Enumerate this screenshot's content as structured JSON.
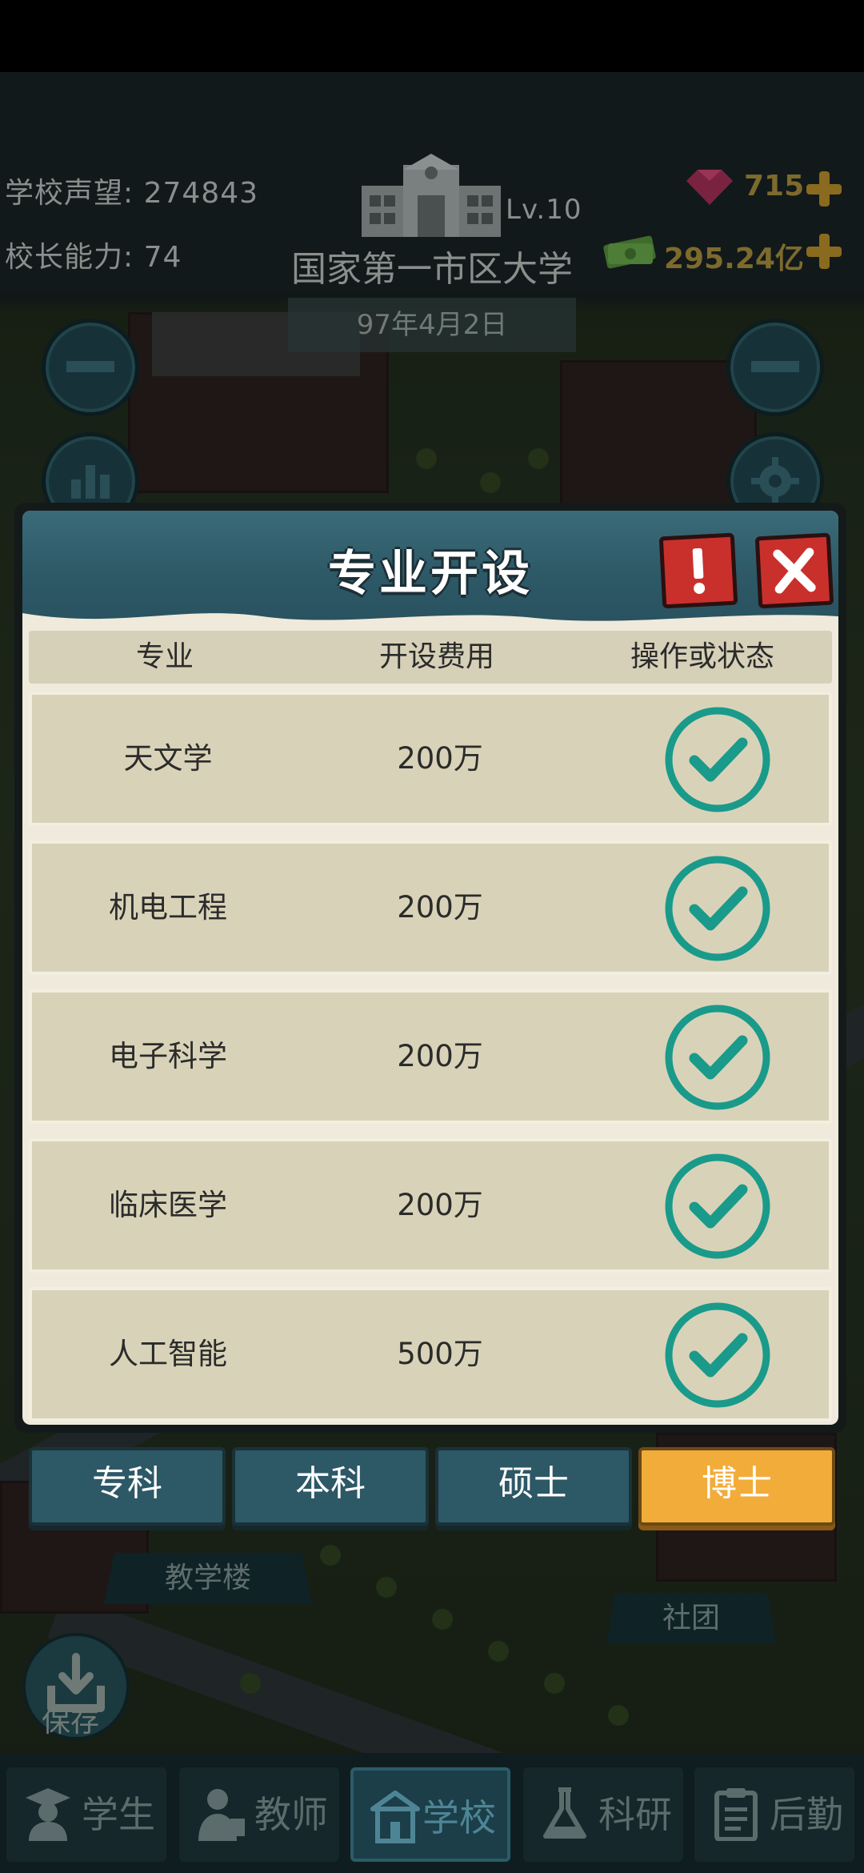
{
  "hud": {
    "reputation_label": "学校声望:",
    "reputation_value": "274843",
    "ability_label": "校长能力:",
    "ability_value": "74",
    "level": "Lv.10",
    "school_name": "国家第一市区大学",
    "date": "97年4月2日",
    "gems": "715",
    "money": "295.24亿"
  },
  "dialog": {
    "title": "专业开设",
    "columns": [
      "专业",
      "开设费用",
      "操作或状态"
    ],
    "rows": [
      {
        "major": "天文学",
        "cost": "200万",
        "status": "opened"
      },
      {
        "major": "机电工程",
        "cost": "200万",
        "status": "opened"
      },
      {
        "major": "电子科学",
        "cost": "200万",
        "status": "opened"
      },
      {
        "major": "临床医学",
        "cost": "200万",
        "status": "opened"
      },
      {
        "major": "人工智能",
        "cost": "500万",
        "status": "opened"
      }
    ]
  },
  "degree_tabs": [
    {
      "label": "专科",
      "active": false
    },
    {
      "label": "本科",
      "active": false
    },
    {
      "label": "硕士",
      "active": false
    },
    {
      "label": "博士",
      "active": true
    }
  ],
  "map_labels": {
    "teaching_building": "教学楼",
    "club": "社团"
  },
  "save_label": "保存",
  "bottom_nav": [
    {
      "label": "学生",
      "icon": "student-icon",
      "active": false
    },
    {
      "label": "教师",
      "icon": "teacher-icon",
      "active": false
    },
    {
      "label": "学校",
      "icon": "school-icon",
      "active": true
    },
    {
      "label": "科研",
      "icon": "flask-icon",
      "active": false
    },
    {
      "label": "后勤",
      "icon": "clipboard-icon",
      "active": false
    }
  ],
  "colors": {
    "check_teal": "#1a9a8a",
    "active_tab": "#f2ac3a",
    "header_teal": "#2d5866"
  }
}
